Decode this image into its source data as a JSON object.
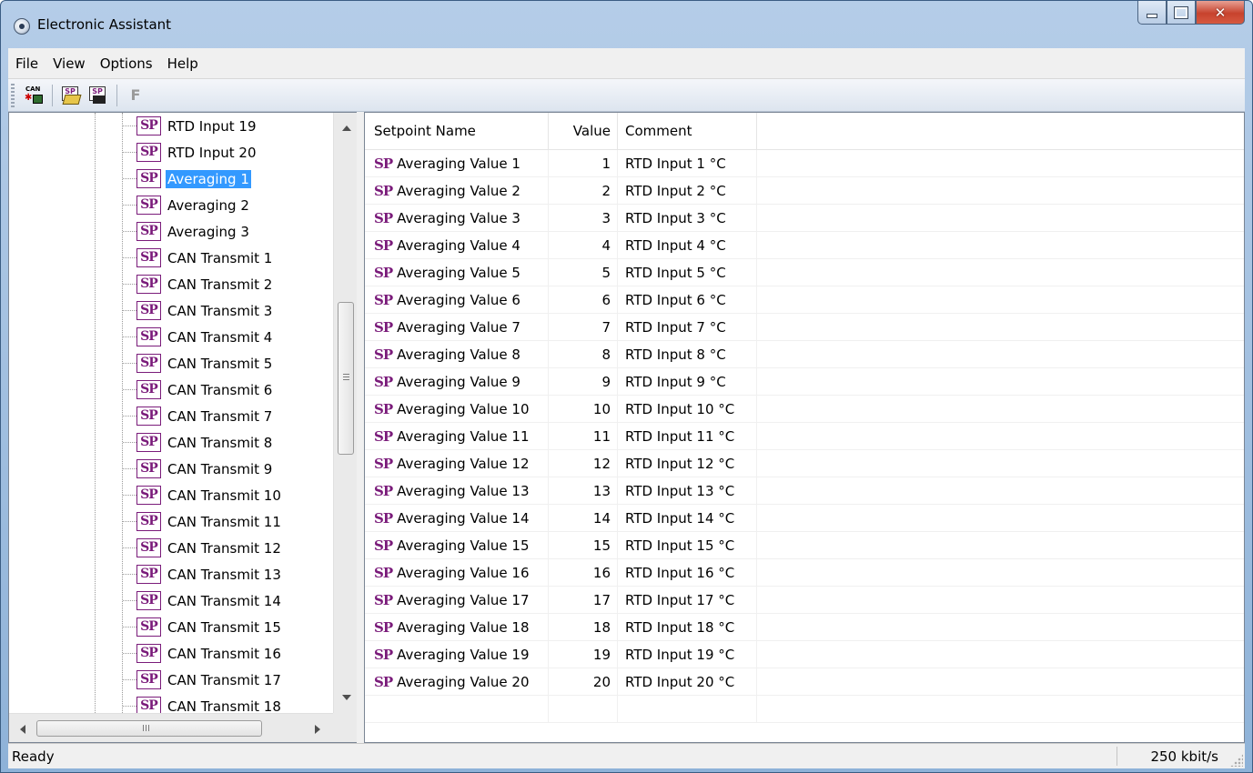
{
  "window": {
    "title": "Electronic Assistant"
  },
  "menu": [
    "File",
    "View",
    "Options",
    "Help"
  ],
  "toolbar": {
    "can_icon_text": "CAN",
    "sp_icon_text": "SP",
    "f_label": "F"
  },
  "tree": {
    "items": [
      {
        "label": "RTD Input 19",
        "selected": false
      },
      {
        "label": "RTD Input 20",
        "selected": false
      },
      {
        "label": "Averaging 1",
        "selected": true
      },
      {
        "label": "Averaging 2",
        "selected": false
      },
      {
        "label": "Averaging 3",
        "selected": false
      },
      {
        "label": "CAN Transmit 1",
        "selected": false
      },
      {
        "label": "CAN Transmit 2",
        "selected": false
      },
      {
        "label": "CAN Transmit 3",
        "selected": false
      },
      {
        "label": "CAN Transmit 4",
        "selected": false
      },
      {
        "label": "CAN Transmit 5",
        "selected": false
      },
      {
        "label": "CAN Transmit 6",
        "selected": false
      },
      {
        "label": "CAN Transmit 7",
        "selected": false
      },
      {
        "label": "CAN Transmit 8",
        "selected": false
      },
      {
        "label": "CAN Transmit 9",
        "selected": false
      },
      {
        "label": "CAN Transmit 10",
        "selected": false
      },
      {
        "label": "CAN Transmit 11",
        "selected": false
      },
      {
        "label": "CAN Transmit 12",
        "selected": false
      },
      {
        "label": "CAN Transmit 13",
        "selected": false
      },
      {
        "label": "CAN Transmit 14",
        "selected": false
      },
      {
        "label": "CAN Transmit 15",
        "selected": false
      },
      {
        "label": "CAN Transmit 16",
        "selected": false
      },
      {
        "label": "CAN Transmit 17",
        "selected": false
      },
      {
        "label": "CAN Transmit 18",
        "selected": false
      }
    ],
    "badge_text": "SP"
  },
  "list": {
    "columns": [
      "Setpoint Name",
      "Value",
      "Comment"
    ],
    "sp_prefix": "SP",
    "rows": [
      {
        "name": "Averaging Value 1",
        "value": "1",
        "comment": "RTD Input 1 °C"
      },
      {
        "name": "Averaging Value 2",
        "value": "2",
        "comment": "RTD Input 2 °C"
      },
      {
        "name": "Averaging Value 3",
        "value": "3",
        "comment": "RTD Input 3 °C"
      },
      {
        "name": "Averaging Value 4",
        "value": "4",
        "comment": "RTD Input 4 °C"
      },
      {
        "name": "Averaging Value 5",
        "value": "5",
        "comment": "RTD Input 5 °C"
      },
      {
        "name": "Averaging Value 6",
        "value": "6",
        "comment": "RTD Input 6 °C"
      },
      {
        "name": "Averaging Value 7",
        "value": "7",
        "comment": "RTD Input 7 °C"
      },
      {
        "name": "Averaging Value 8",
        "value": "8",
        "comment": "RTD Input 8 °C"
      },
      {
        "name": "Averaging Value 9",
        "value": "9",
        "comment": "RTD Input 9 °C"
      },
      {
        "name": "Averaging Value 10",
        "value": "10",
        "comment": "RTD Input 10 °C"
      },
      {
        "name": "Averaging Value 11",
        "value": "11",
        "comment": "RTD Input 11 °C"
      },
      {
        "name": "Averaging Value 12",
        "value": "12",
        "comment": "RTD Input 12 °C"
      },
      {
        "name": "Averaging Value 13",
        "value": "13",
        "comment": "RTD Input 13 °C"
      },
      {
        "name": "Averaging Value 14",
        "value": "14",
        "comment": "RTD Input 14 °C"
      },
      {
        "name": "Averaging Value 15",
        "value": "15",
        "comment": "RTD Input 15 °C"
      },
      {
        "name": "Averaging Value 16",
        "value": "16",
        "comment": "RTD Input 16 °C"
      },
      {
        "name": "Averaging Value 17",
        "value": "17",
        "comment": "RTD Input 17 °C"
      },
      {
        "name": "Averaging Value 18",
        "value": "18",
        "comment": "RTD Input 18 °C"
      },
      {
        "name": "Averaging Value 19",
        "value": "19",
        "comment": "RTD Input 19 °C"
      },
      {
        "name": "Averaging Value 20",
        "value": "20",
        "comment": "RTD Input 20 °C"
      }
    ]
  },
  "status": {
    "text": "Ready",
    "rate": "250 kbit/s"
  },
  "colors": {
    "sp_accent": "#7a1b7a",
    "selection": "#3399ff",
    "title_gradient_top": "#b5cde8"
  }
}
